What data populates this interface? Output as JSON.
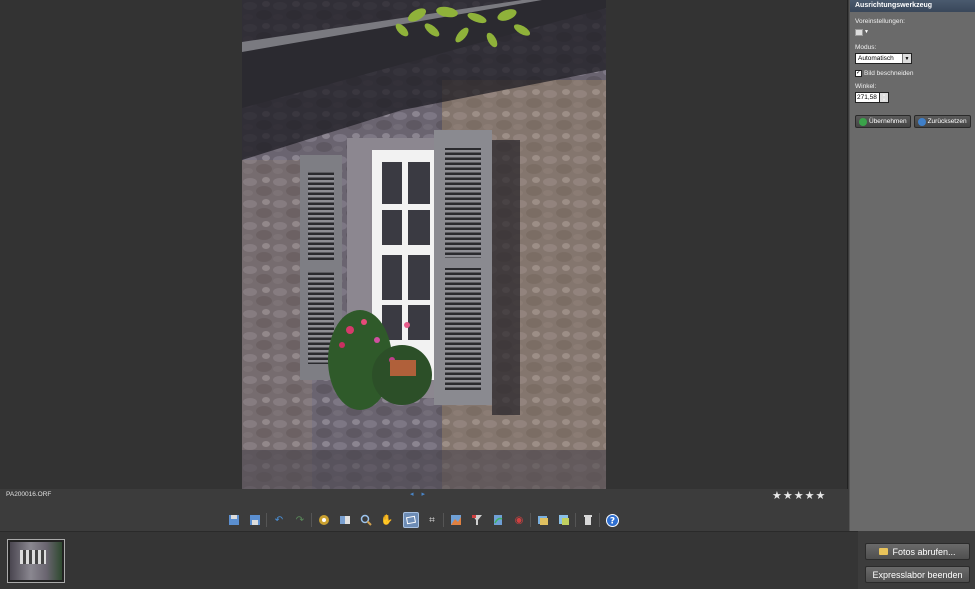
{
  "status": {
    "filename": "PA200016.ORF",
    "nav": "◂▸",
    "rating": "★★★★★"
  },
  "panel": {
    "title": "Ausrichtungswerkzeug",
    "presets_label": "Voreinstellungen:",
    "mode_label": "Modus:",
    "mode_value": "Automatisch",
    "crop_label": "Bild beschneiden",
    "crop_checked": true,
    "angle_label": "Winkel:",
    "angle_value": "271,58",
    "apply_label": "Übernehmen",
    "reset_label": "Zurücksetzen"
  },
  "actions": {
    "get_photos": "Fotos abrufen...",
    "exit": "Expresslabor beenden"
  },
  "icons": {
    "save": "save-icon",
    "save_as": "save-as-icon",
    "undo": "undo-icon",
    "redo": "redo-icon",
    "fix": "auto-fix-icon",
    "compare": "compare-icon",
    "zoom": "zoom-icon",
    "hand": "hand-icon",
    "straighten": "straighten-icon",
    "crop": "crop-icon",
    "levels": "levels-icon",
    "filter": "filter-icon",
    "rotate": "rotate-icon",
    "redeye": "red-eye-icon",
    "export1": "export-icon",
    "export2": "share-icon",
    "delete": "trash-icon",
    "help": "help-icon"
  },
  "colors": {
    "accent": "#6d8cb5",
    "apply": "#3aa34a",
    "reset": "#3f7fc8",
    "help": "#2f6fd0"
  }
}
